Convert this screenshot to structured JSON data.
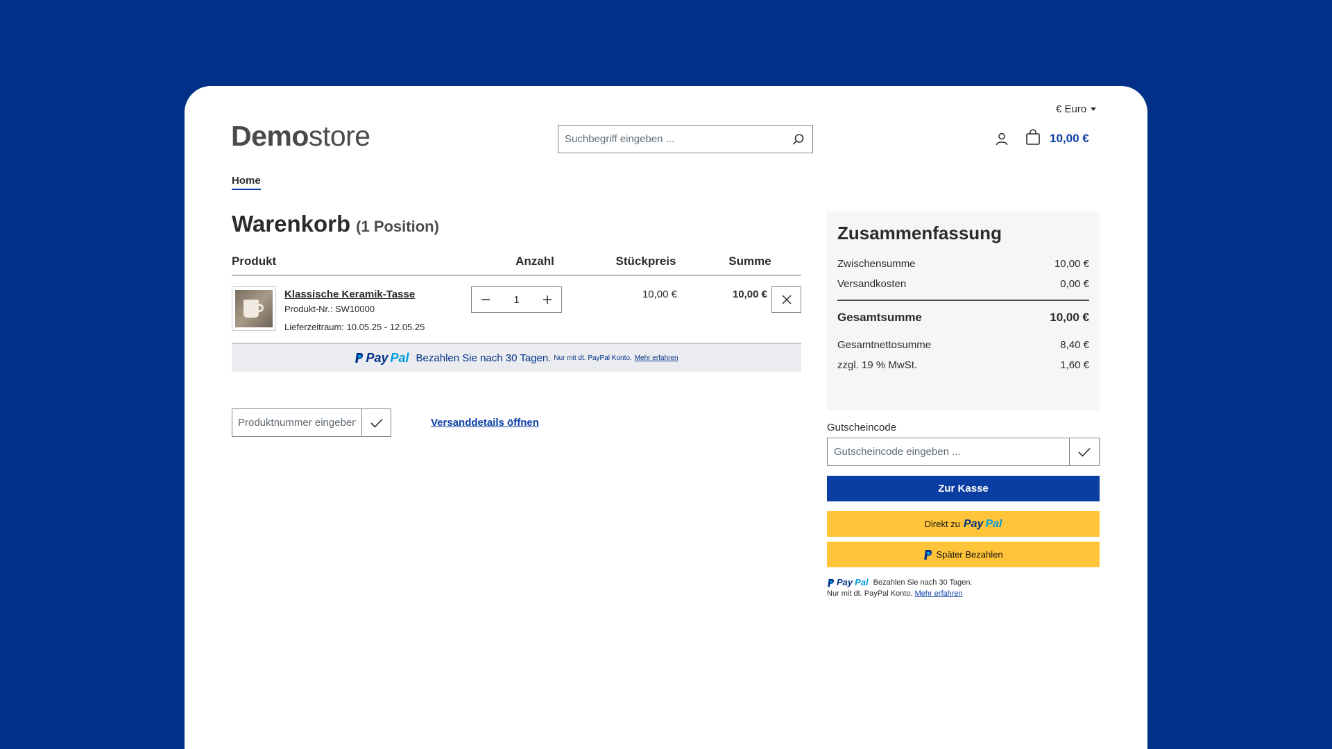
{
  "header": {
    "currency": "€ Euro",
    "logo_bold": "Demo",
    "logo_light": "store",
    "search_placeholder": "Suchbegriff eingeben ...",
    "cart_total": "10,00 €"
  },
  "breadcrumb": {
    "home": "Home"
  },
  "cart": {
    "title": "Warenkorb",
    "count_label": "(1 Position)",
    "columns": {
      "product": "Produkt",
      "quantity": "Anzahl",
      "unit_price": "Stückpreis",
      "total": "Summe"
    },
    "items": [
      {
        "name": "Klassische Keramik-Tasse",
        "product_number": "Produkt-Nr.: SW10000",
        "delivery": "Lieferzeitraum: 10.05.25 - 12.05.25",
        "quantity": "1",
        "unit_price": "10,00 €",
        "total": "10,00 €"
      }
    ],
    "paypal_banner": {
      "pay": "Pay",
      "pal": "Pal",
      "text": "Bezahlen Sie nach 30 Tagen.",
      "small": "Nur mit dt. PayPal Konto.",
      "link": "Mehr erfahren"
    },
    "product_number_placeholder": "Produktnummer eingeben ...",
    "shipping_link": "Versanddetails öffnen"
  },
  "summary": {
    "title": "Zusammenfassung",
    "subtotal_label": "Zwischensumme",
    "subtotal_value": "10,00 €",
    "shipping_label": "Versandkosten",
    "shipping_value": "0,00 €",
    "total_label": "Gesamtsumme",
    "total_value": "10,00 €",
    "net_label": "Gesamtnettosumme",
    "net_value": "8,40 €",
    "vat_label": "zzgl. 19 % MwSt.",
    "vat_value": "1,60 €"
  },
  "voucher": {
    "label": "Gutscheincode",
    "placeholder": "Gutscheincode eingeben ..."
  },
  "checkout": {
    "button": "Zur Kasse",
    "paypal_direct_prefix": "Direkt zu",
    "paypal_later": "Später Bezahlen"
  },
  "paypal_note": {
    "line1": "Bezahlen Sie nach 30 Tagen.",
    "line2": "Nur mit dt. PayPal Konto.",
    "link": "Mehr erfahren"
  },
  "colors": {
    "background": "#003087",
    "primary": "#0b3ea3",
    "paypal_yellow": "#ffc439"
  }
}
